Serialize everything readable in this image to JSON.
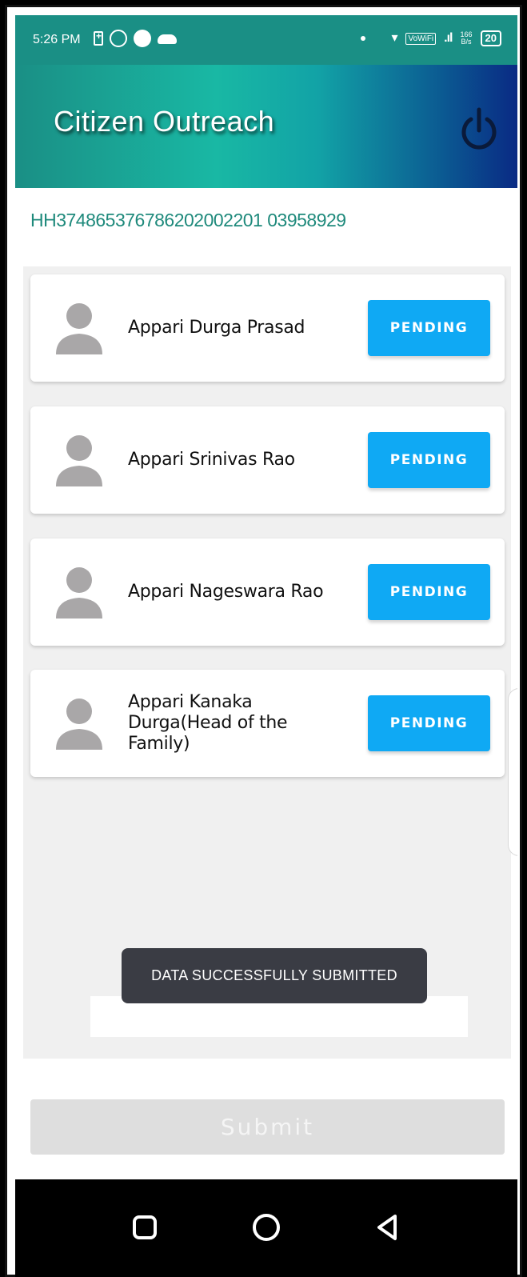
{
  "status_bar": {
    "time": "5:26 PM",
    "vowifi": "VoWiFi",
    "speed_value": "166",
    "speed_unit": "B/s",
    "battery": "20",
    "icons": [
      "battery-charging-icon",
      "whatsapp-icon",
      "circle-icon",
      "cloud-icon",
      "dot-icon",
      "wifi-icon",
      "signal-icon"
    ]
  },
  "app_bar": {
    "title": "Citizen Outreach",
    "power_icon": "power-icon"
  },
  "household_id": "HH374865376786202002201 03958929",
  "members": [
    {
      "name": "Appari Durga Prasad",
      "status": "PENDING"
    },
    {
      "name": "Appari Srinivas Rao",
      "status": "PENDING"
    },
    {
      "name": "Appari Nageswara Rao",
      "status": "PENDING"
    },
    {
      "name": "Appari Kanaka Durga(Head of the Family)",
      "status": "PENDING"
    }
  ],
  "toast": "DATA SUCCESSFULLY SUBMITTED",
  "submit_label": "Submit",
  "nav": {
    "recents_icon": "square-icon",
    "home_icon": "circle-icon",
    "back_icon": "triangle-back-icon"
  },
  "colors": {
    "accent": "#0fa9f4",
    "appbar_start": "#1a8f85",
    "appbar_end": "#0a2a84",
    "id_text": "#1f8a7c",
    "toast_bg": "#3a3c44"
  }
}
